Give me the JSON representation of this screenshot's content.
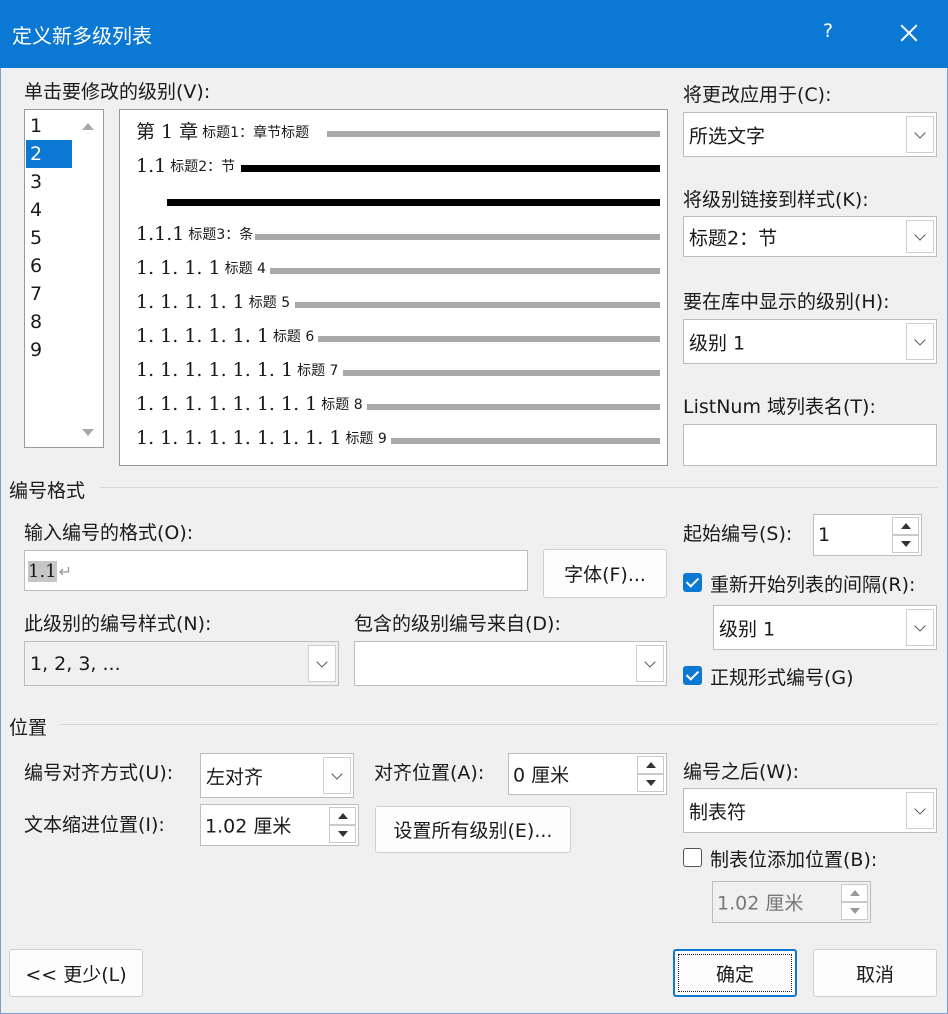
{
  "titlebar": {
    "title": "定义新多级列表",
    "help": "?"
  },
  "level_section": {
    "label": "单击要修改的级别(V):",
    "levels": [
      "1",
      "2",
      "3",
      "4",
      "5",
      "6",
      "7",
      "8",
      "9"
    ],
    "selected": "2"
  },
  "preview": {
    "rows": [
      {
        "num": "第 1 章",
        "style": "标题1：章节标题"
      },
      {
        "num": "1.1",
        "style": "标题2：节"
      },
      {
        "num": "1.1.1",
        "style": "标题3：条"
      },
      {
        "num": "1. 1. 1. 1",
        "style": "标题 4"
      },
      {
        "num": "1. 1. 1. 1. 1",
        "style": "标题 5"
      },
      {
        "num": "1. 1. 1. 1. 1. 1",
        "style": "标题 6"
      },
      {
        "num": "1. 1. 1. 1. 1. 1. 1",
        "style": "标题 7"
      },
      {
        "num": "1. 1. 1. 1. 1. 1. 1. 1",
        "style": "标题 8"
      },
      {
        "num": "1. 1. 1. 1. 1. 1. 1. 1. 1",
        "style": "标题 9"
      }
    ]
  },
  "right_panel": {
    "apply_label": "将更改应用于(C):",
    "apply_value": "所选文字",
    "link_label": "将级别链接到样式(K):",
    "link_value": "标题2：节",
    "gallery_label": "要在库中显示的级别(H):",
    "gallery_value": "级别 1",
    "listnum_label": "ListNum 域列表名(T):",
    "listnum_value": ""
  },
  "number_format": {
    "section_title": "编号格式",
    "format_label": "输入编号的格式(O):",
    "format_value": "1.1",
    "para_mark": "↵",
    "font_button": "字体(F)...",
    "style_label": "此级别的编号样式(N):",
    "style_value": "1, 2, 3, ...",
    "include_label": "包含的级别编号来自(D):",
    "include_value": "",
    "start_label": "起始编号(S):",
    "start_value": "1",
    "restart_label": "重新开始列表的间隔(R):",
    "restart_checked": true,
    "restart_value": "级别 1",
    "legal_label": "正规形式编号(G)",
    "legal_checked": true
  },
  "position": {
    "section_title": "位置",
    "align_label": "编号对齐方式(U):",
    "align_value": "左对齐",
    "align_at_label": "对齐位置(A):",
    "align_at_value": "0 厘米",
    "indent_label": "文本缩进位置(I):",
    "indent_value": "1.02 厘米",
    "set_all_button": "设置所有级别(E)...",
    "follow_label": "编号之后(W):",
    "follow_value": "制表符",
    "tab_add_label": "制表位添加位置(B):",
    "tab_add_checked": false,
    "tab_add_value": "1.02 厘米"
  },
  "footer": {
    "less_button": "<< 更少(L)",
    "ok_button": "确定",
    "cancel_button": "取消"
  },
  "colors": {
    "accent": "#0b78d4",
    "dialog_bg": "#f0f0f0"
  }
}
